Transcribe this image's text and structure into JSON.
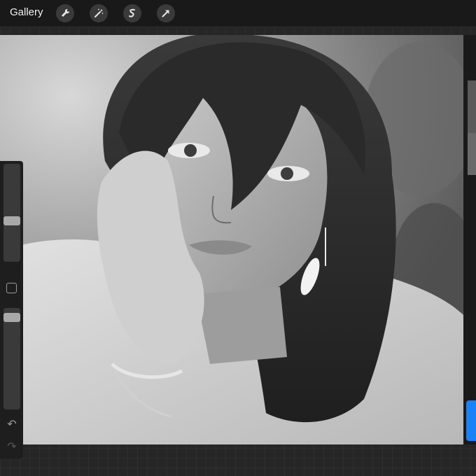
{
  "toolbar": {
    "gallery_label": "Gallery",
    "tools": [
      {
        "name": "wrench-icon"
      },
      {
        "name": "magic-wand-icon"
      },
      {
        "name": "selection-icon"
      },
      {
        "name": "transform-arrow-icon"
      }
    ]
  },
  "sidebar": {
    "size_slider_level": 0.41,
    "opacity_slider_level": 0.95
  },
  "colors": {
    "accent": "#1a82f7",
    "toolbar_bg": "#191919",
    "canvas_bg": "#262626"
  }
}
